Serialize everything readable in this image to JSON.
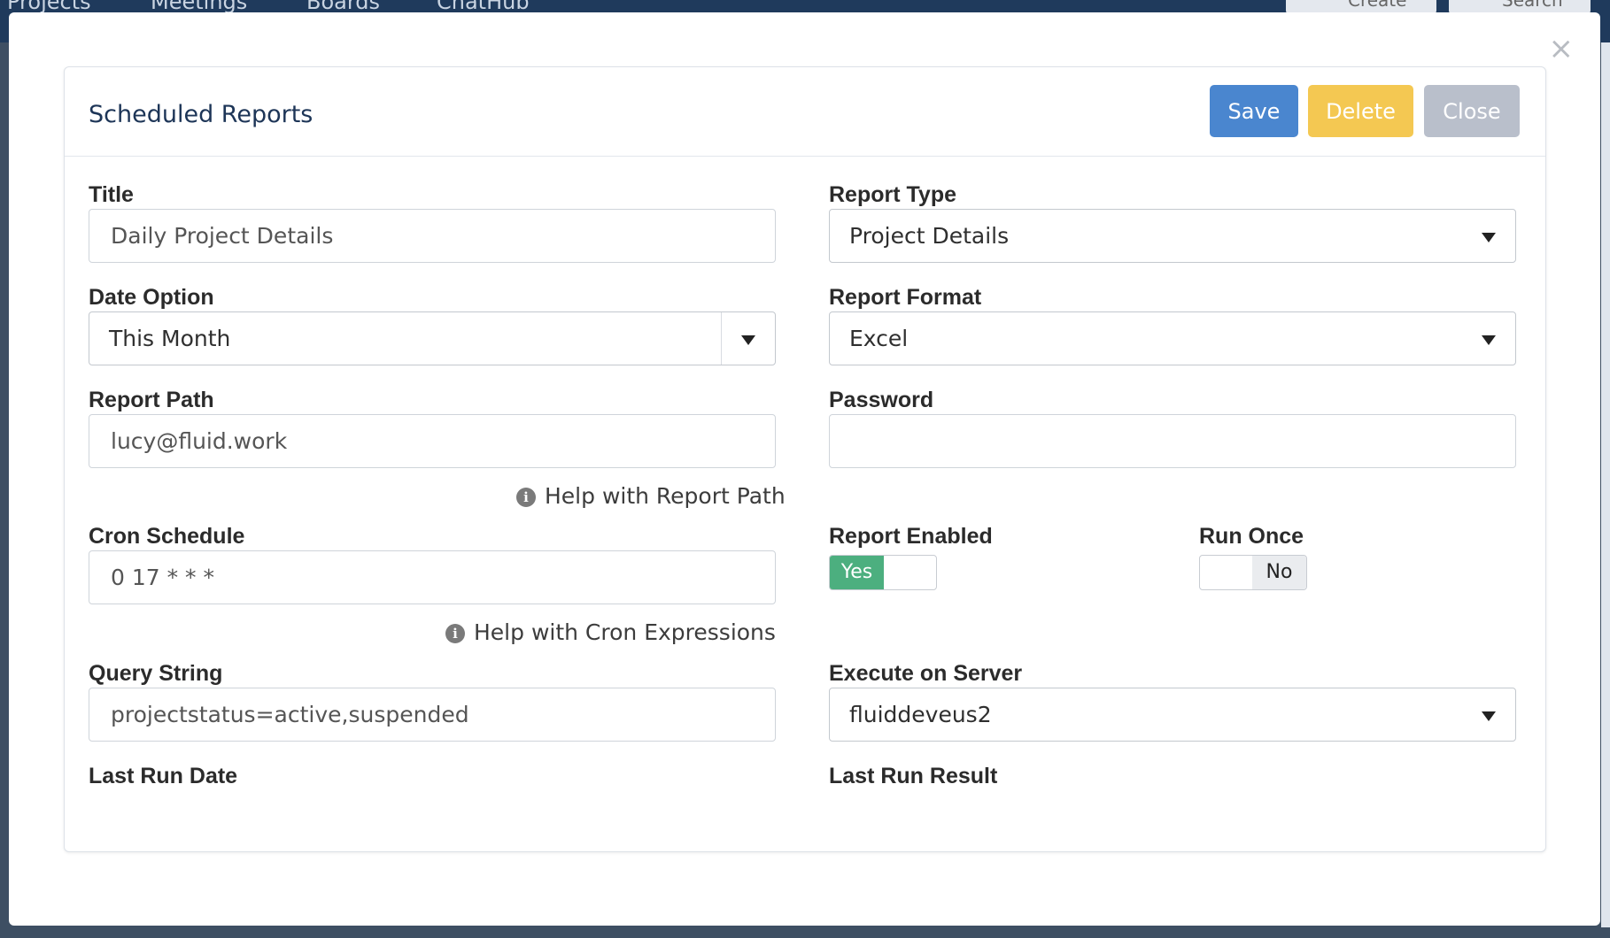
{
  "background_nav": {
    "items": [
      "Projects",
      "Meetings",
      "Boards",
      "ChatHub"
    ],
    "create_label": "Create",
    "search_label": "Search"
  },
  "panel": {
    "title": "Scheduled Reports",
    "save_label": "Save",
    "delete_label": "Delete",
    "close_label": "Close"
  },
  "form": {
    "title_label": "Title",
    "title_value": "Daily Project Details",
    "report_type_label": "Report Type",
    "report_type_value": "Project Details",
    "date_option_label": "Date Option",
    "date_option_value": "This Month",
    "report_format_label": "Report Format",
    "report_format_value": "Excel",
    "report_path_label": "Report Path",
    "report_path_value": "lucy@fluid.work",
    "report_path_help": "Help with Report Path",
    "password_label": "Password",
    "password_value": "",
    "cron_label": "Cron Schedule",
    "cron_value": "0 17 * * *",
    "cron_help": "Help with Cron Expressions",
    "report_enabled_label": "Report Enabled",
    "report_enabled_value": "Yes",
    "run_once_label": "Run Once",
    "run_once_value": "No",
    "query_string_label": "Query String",
    "query_string_value": "projectstatus=active,suspended",
    "execute_server_label": "Execute on Server",
    "execute_server_value": "fluiddeveus2",
    "last_run_date_label": "Last Run Date",
    "last_run_result_label": "Last Run Result"
  },
  "colors": {
    "save": "#4a86cf",
    "delete": "#f4c852",
    "close": "#b9bfcb",
    "toggle_on": "#4caf7f"
  }
}
